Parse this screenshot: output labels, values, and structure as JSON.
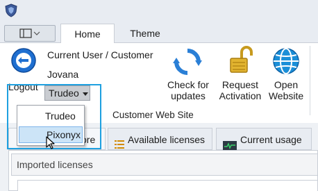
{
  "tabs": {
    "home": "Home",
    "theme": "Theme"
  },
  "user": {
    "heading": "Current User / Customer",
    "name": "Jovana",
    "logout_label": "Logout",
    "customer_selected": "Trudeo",
    "customer_options": [
      "Trudeo",
      "Pixonyx"
    ]
  },
  "ribbon": {
    "check_updates_line1": "Check for",
    "check_updates_line2": "updates",
    "request_line1": "Request",
    "request_line2": "Activation",
    "open_line1": "Open",
    "open_line2": "Website",
    "group_label": "Customer Web Site"
  },
  "content_tabs": {
    "first_partial": "ore",
    "available": "Available licenses",
    "usage": "Current usage"
  },
  "panel": {
    "header": "Imported licenses"
  },
  "colors": {
    "accent": "#1ea0e0",
    "ribbon_bg": "#e8ecf2",
    "selection": "#cce4f7"
  },
  "icons": [
    "app-icon",
    "quick-access-icon",
    "logout-icon",
    "refresh-icon",
    "padlock-icon",
    "globe-icon",
    "list-icon",
    "monitor-icon",
    "cursor-icon"
  ]
}
